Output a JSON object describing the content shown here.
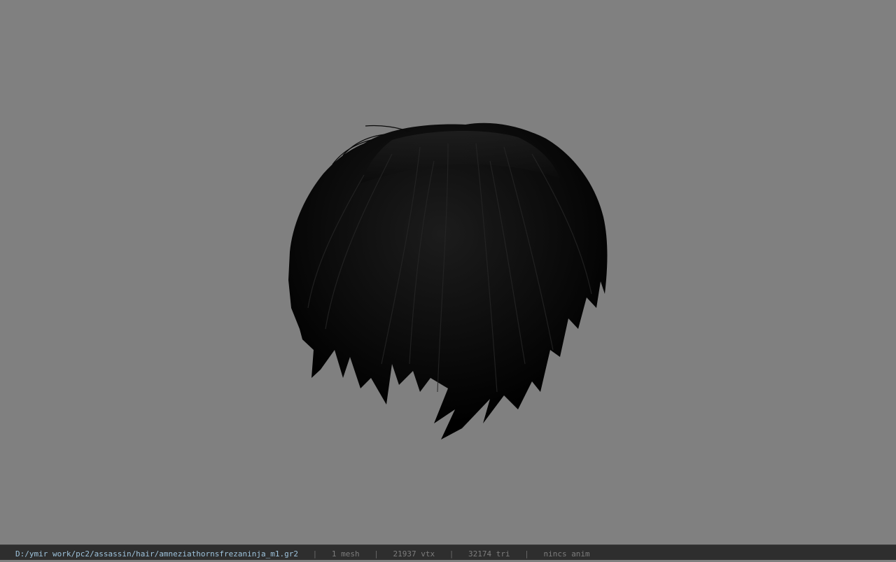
{
  "viewport": {
    "background": "#808080",
    "model_icon": "hair-mesh"
  },
  "statusbar": {
    "path": "D:/ymir work/pc2/assassin/hair/amneziathornsfrezaninja_m1.gr2",
    "separator": "|",
    "mesh": "1 mesh",
    "vertices": "21937 vtx",
    "triangles": "32174 tri",
    "anim": "nincs anim"
  }
}
